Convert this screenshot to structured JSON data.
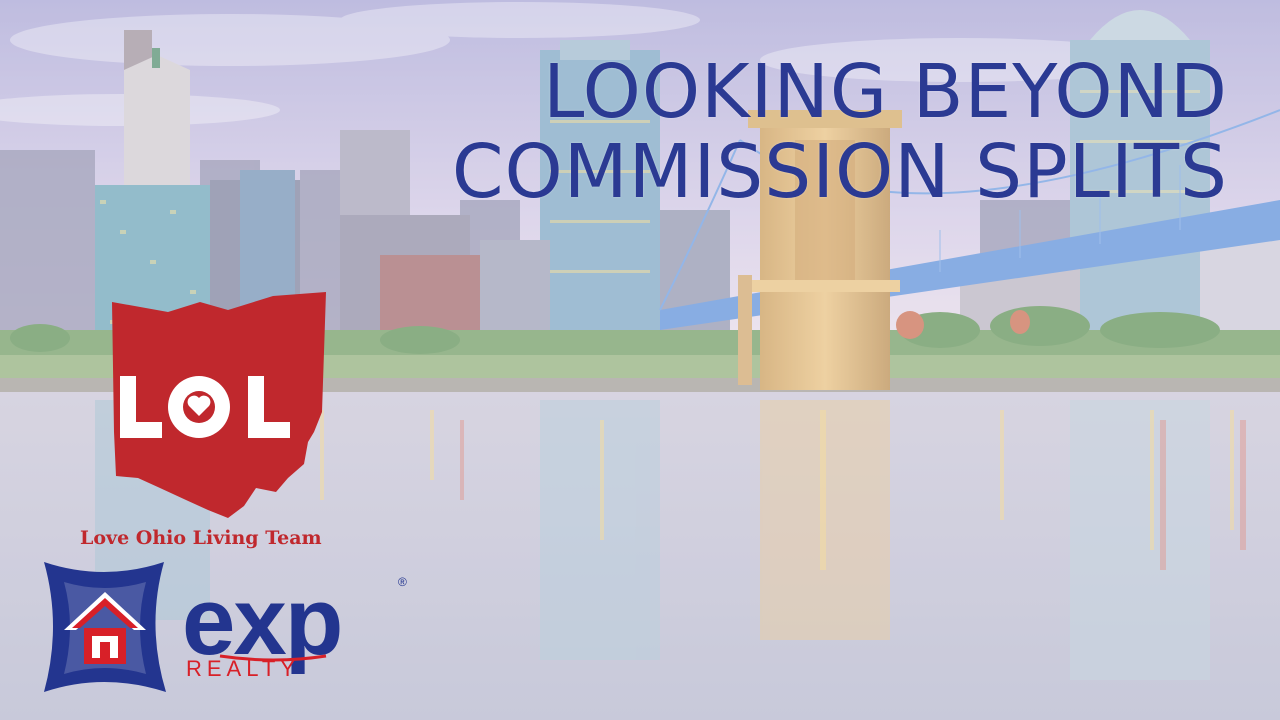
{
  "headline": {
    "line1": "LOOKING BEYOND",
    "line2": "COMMISSION SPLITS"
  },
  "lol_logo": {
    "letters": "LOL",
    "color": "#c0282d"
  },
  "team_name": "Love Ohio Living Team",
  "exp_logo": {
    "wordmark": "exp",
    "subtext": "REALTY",
    "registered": "®",
    "blue": "#23358f",
    "red": "#d82028"
  },
  "colors": {
    "headline": "#2b3a93",
    "sky_top": "#a9a5d6",
    "sky_bottom": "#e6d8e8",
    "water": "#b9b8cf"
  }
}
